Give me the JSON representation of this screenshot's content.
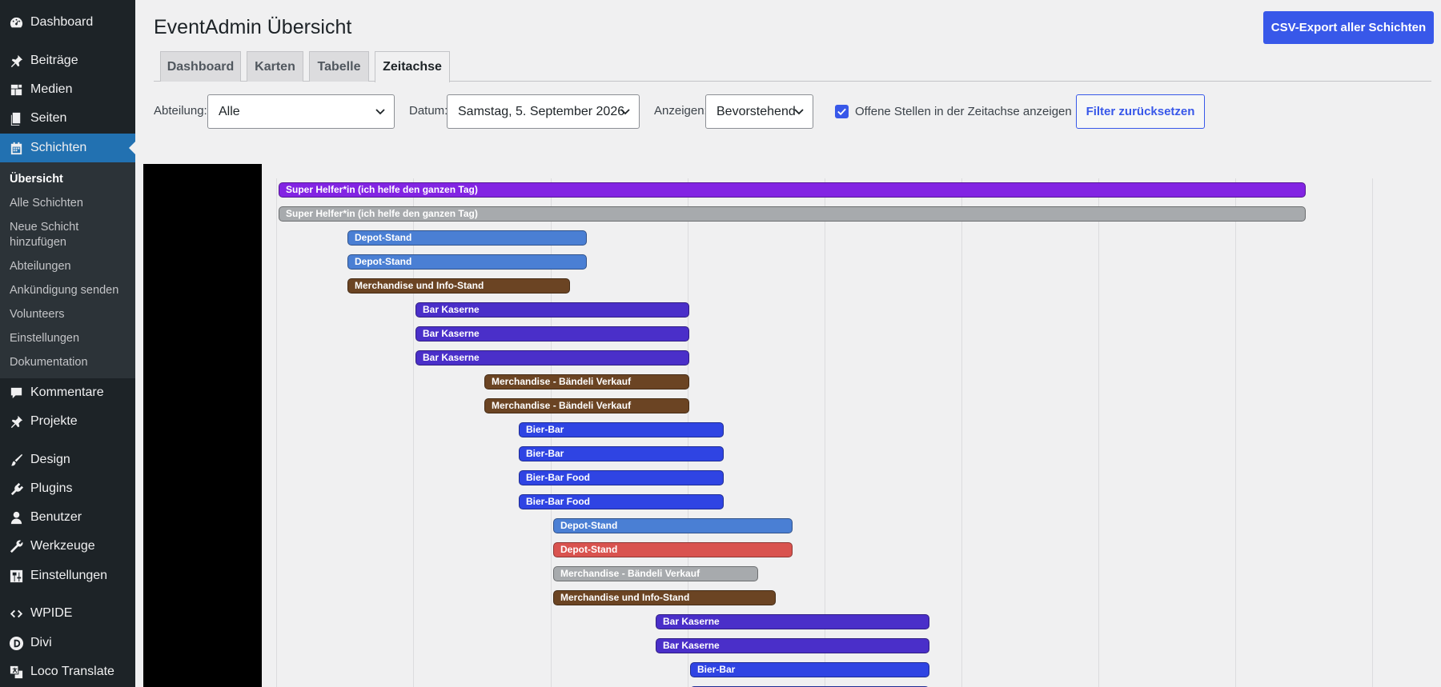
{
  "sidebar": {
    "items": [
      {
        "label": "Dashboard",
        "icon": "dashboard-icon"
      },
      {
        "label": "Beiträge",
        "icon": "pin-icon"
      },
      {
        "label": "Medien",
        "icon": "media-icon"
      },
      {
        "label": "Seiten",
        "icon": "pages-icon"
      },
      {
        "label": "Schichten",
        "icon": "calendar-icon",
        "active": true
      },
      {
        "label": "Kommentare",
        "icon": "comment-icon"
      },
      {
        "label": "Projekte",
        "icon": "pin-icon"
      },
      {
        "label": "Design",
        "icon": "brush-icon"
      },
      {
        "label": "Plugins",
        "icon": "plugin-icon"
      },
      {
        "label": "Benutzer",
        "icon": "user-icon"
      },
      {
        "label": "Werkzeuge",
        "icon": "wrench-icon"
      },
      {
        "label": "Einstellungen",
        "icon": "settings-icon"
      },
      {
        "label": "WPIDE",
        "icon": "code-icon"
      },
      {
        "label": "Divi",
        "icon": "divi-icon"
      },
      {
        "label": "Loco Translate",
        "icon": "translate-icon"
      }
    ],
    "submenu": [
      "Übersicht",
      "Alle Schichten",
      "Neue Schicht hinzufügen",
      "Abteilungen",
      "Ankündigung senden",
      "Volunteers",
      "Einstellungen",
      "Dokumentation"
    ]
  },
  "header": {
    "title": "EventAdmin Übersicht",
    "csv_button": "CSV-Export aller Schichten"
  },
  "tabs": [
    "Dashboard",
    "Karten",
    "Tabelle",
    "Zeitachse"
  ],
  "active_tab": "Zeitachse",
  "filters": {
    "abteilung_label": "Abteilung:",
    "abteilung_value": "Alle",
    "datum_label": "Datum:",
    "datum_value": "Samstag, 5. September 2026",
    "anzeigen_label": "Anzeigen:",
    "anzeigen_value": "Bevorstehend",
    "open_positions_label": "Offene Stellen in der Zeitachse anzeigen",
    "open_positions_checked": true,
    "reset_button": "Filter zurücksetzen"
  },
  "colors": {
    "accent": "#3858e9",
    "sidebar_bg": "#1d2327",
    "active_menu": "#2271b1"
  },
  "timeline": {
    "bars": [
      {
        "label": "Super Helfer*in (ich helfe den ganzen Tag)",
        "color": "#8224e3"
      },
      {
        "label": "Super Helfer*in (ich helfe den ganzen Tag)",
        "color": "#a7aaad"
      },
      {
        "label": "Depot-Stand",
        "color": "#4a7fd4"
      },
      {
        "label": "Depot-Stand",
        "color": "#4a7fd4"
      },
      {
        "label": "Merchandise und Info-Stand",
        "color": "#6b4423"
      },
      {
        "label": "Bar Kaserne",
        "color": "#4a2fc9"
      },
      {
        "label": "Bar Kaserne",
        "color": "#4a2fc9"
      },
      {
        "label": "Bar Kaserne",
        "color": "#4a2fc9"
      },
      {
        "label": "Merchandise - Bändeli Verkauf",
        "color": "#6b4423"
      },
      {
        "label": "Merchandise - Bändeli Verkauf",
        "color": "#6b4423"
      },
      {
        "label": "Bier-Bar",
        "color": "#2f44e3"
      },
      {
        "label": "Bier-Bar",
        "color": "#2f44e3"
      },
      {
        "label": "Bier-Bar Food",
        "color": "#2f44e3"
      },
      {
        "label": "Bier-Bar Food",
        "color": "#2f44e3"
      },
      {
        "label": "Depot-Stand",
        "color": "#4a7fd4"
      },
      {
        "label": "Depot-Stand",
        "color": "#d9534f"
      },
      {
        "label": "Merchandise - Bändeli Verkauf",
        "color": "#a7aaad"
      },
      {
        "label": "Merchandise und Info-Stand",
        "color": "#6b4423"
      },
      {
        "label": "Bar Kaserne",
        "color": "#4a2fc9"
      },
      {
        "label": "Bar Kaserne",
        "color": "#4a2fc9"
      },
      {
        "label": "Bier-Bar",
        "color": "#2f44e3"
      },
      {
        "label": "",
        "color": "#2f44e3"
      }
    ]
  }
}
